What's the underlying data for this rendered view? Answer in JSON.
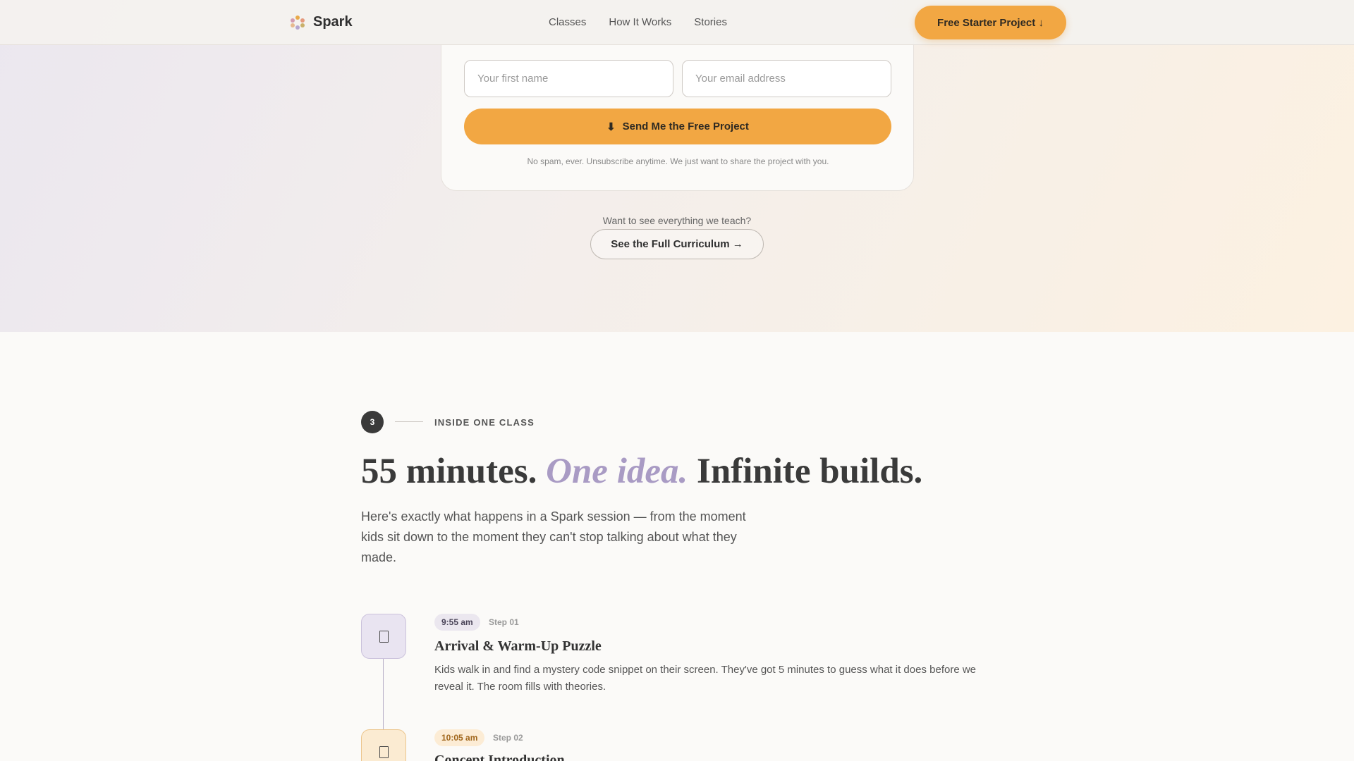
{
  "nav": {
    "brand": "Spark",
    "links": [
      "Classes",
      "How It Works",
      "Stories"
    ],
    "cta": "Free Starter Project ↓"
  },
  "form": {
    "first_name_placeholder": "Your first name",
    "email_placeholder": "Your email address",
    "submit_icon": "⬇",
    "submit_label": "Send Me the Free Project",
    "note": "No spam, ever. Unsubscribe anytime. We just want to share the project with you."
  },
  "curriculum": {
    "question": "Want to see everything we teach?",
    "button": "See the Full Curriculum →"
  },
  "section": {
    "number": "3",
    "label": "INSIDE ONE CLASS",
    "headline_a": "55 minutes. ",
    "headline_em": "One idea.",
    "headline_b": " Infinite builds.",
    "lede": "Here's exactly what happens in a Spark session — from the moment kids sit down to the moment they can't stop talking about what they made."
  },
  "timeline": [
    {
      "time": "9:55 am",
      "step": "Step 01",
      "title": "Arrival & Warm-Up Puzzle",
      "description": "Kids walk in and find a mystery code snippet on their screen. They've got 5 minutes to guess what it does before we reveal it. The room fills with theories."
    },
    {
      "time": "10:05 am",
      "step": "Step 02",
      "title": "Concept Introduction"
    }
  ],
  "colors": {
    "accent": "#f2a743",
    "lavender": "#a99bc4",
    "dark": "#3a3a3a"
  }
}
